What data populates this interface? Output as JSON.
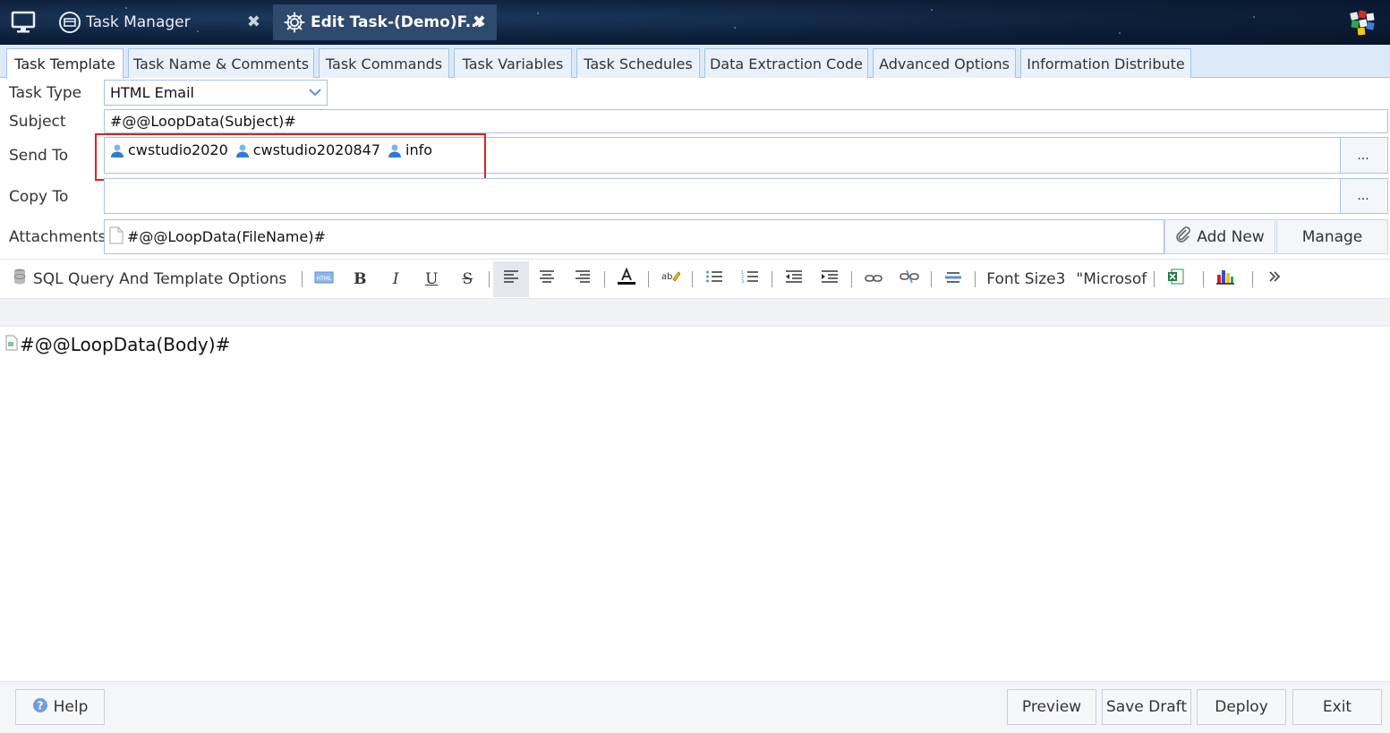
{
  "titlebar": {
    "tabs": [
      {
        "label": "Task Manager"
      },
      {
        "label": "Edit Task-(Demo)F..."
      }
    ]
  },
  "tabs": [
    {
      "label": "Task Template"
    },
    {
      "label": "Task Name & Comments"
    },
    {
      "label": "Task Commands"
    },
    {
      "label": "Task Variables"
    },
    {
      "label": "Task Schedules"
    },
    {
      "label": "Data Extraction Code"
    },
    {
      "label": "Advanced Options"
    },
    {
      "label": "Information Distribute"
    }
  ],
  "form": {
    "task_type": {
      "label": "Task Type",
      "value": "HTML Email"
    },
    "subject": {
      "label": "Subject",
      "value": "#@@LoopData(Subject)#"
    },
    "send_to": {
      "label": "Send To",
      "recipients": [
        "cwstudio2020",
        "cwstudio2020847",
        "info"
      ],
      "button": "..."
    },
    "copy_to": {
      "label": "Copy To",
      "button": "..."
    },
    "attachments": {
      "label": "Attachments",
      "value": "#@@LoopData(FileName)#",
      "add_new": "Add New",
      "manage": "Manage"
    }
  },
  "toolbar": {
    "sql_options": "SQL Query And Template Options",
    "bold": "B",
    "italic": "I",
    "underline": "U",
    "strike": "S",
    "font_size": "Font Size3",
    "font_name": "\"Microsof"
  },
  "editor": {
    "body": "#@@LoopData(Body)#"
  },
  "footer": {
    "help": "Help",
    "preview": "Preview",
    "save_draft": "Save Draft",
    "deploy": "Deploy",
    "exit": "Exit"
  },
  "colors": {
    "accent_red": "#e02020",
    "tab_border": "#a7c3e2",
    "titlebar": "#0d1f3a"
  }
}
